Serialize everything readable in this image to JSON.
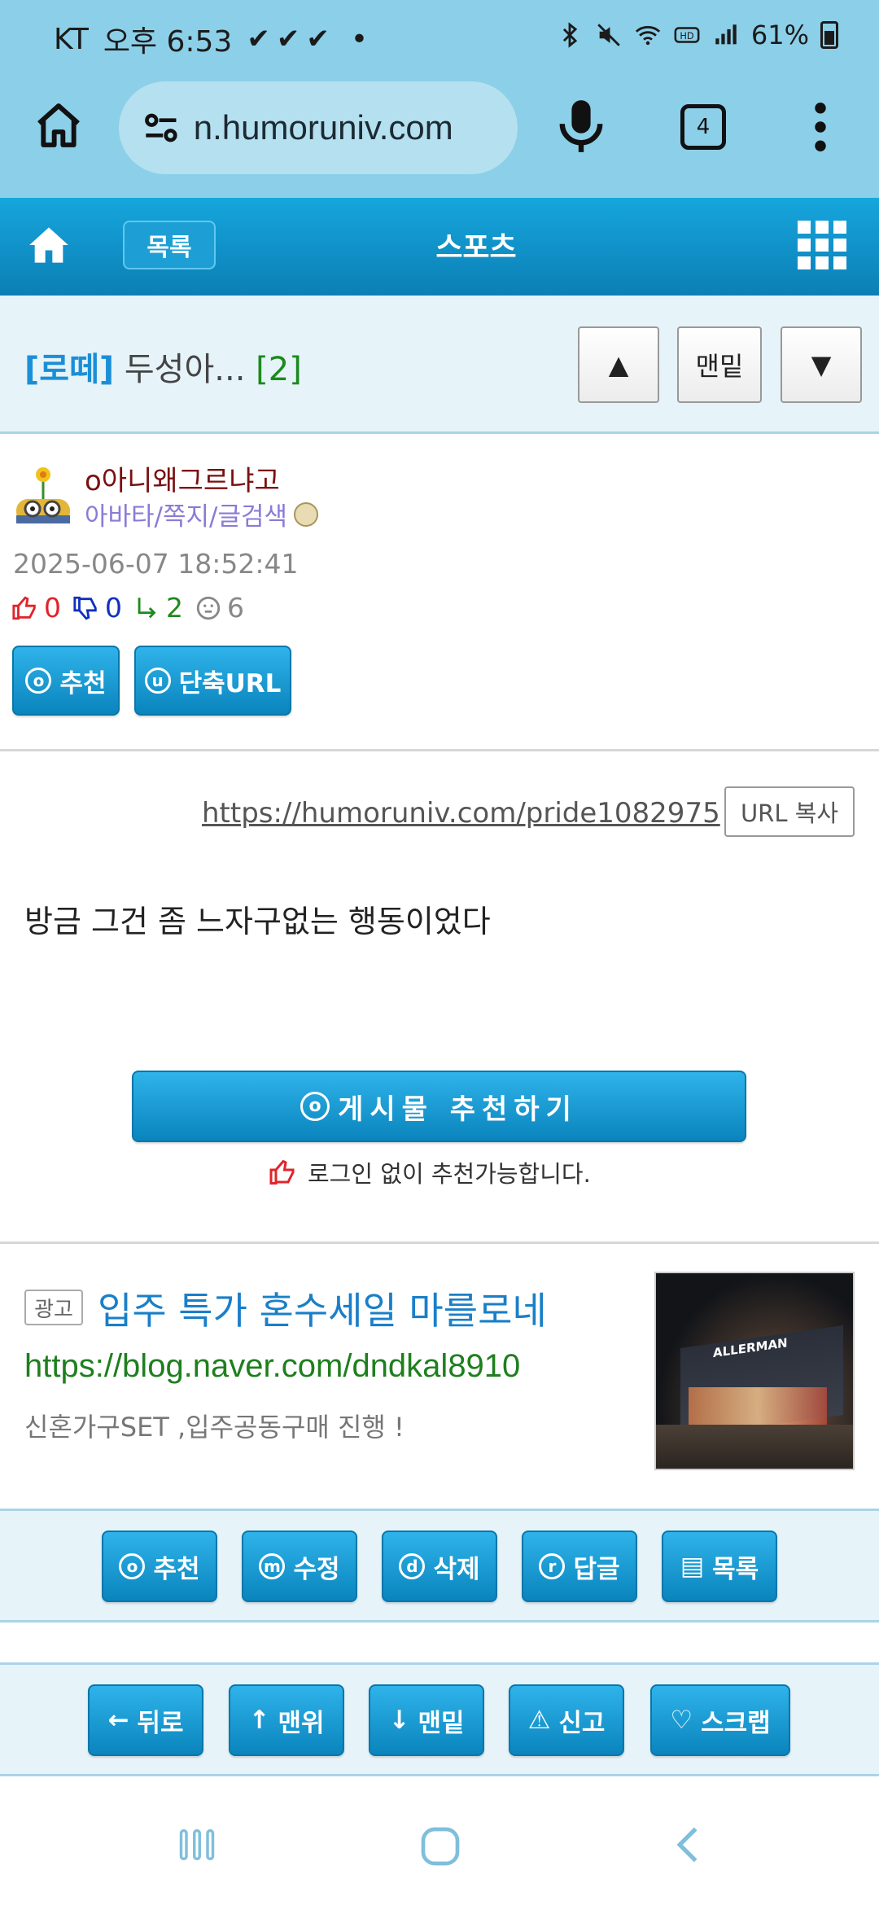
{
  "status_bar": {
    "carrier": "KT",
    "time": "오후 6:53",
    "checks": "✔✔✔",
    "dot": "•",
    "battery": "61%",
    "icons": [
      "bluetooth-icon",
      "mute-icon",
      "wifi-icon",
      "hd-icon",
      "signal-icon",
      "battery-icon"
    ]
  },
  "browser": {
    "url": "n.humoruniv.com",
    "tab_count": "4",
    "icons": [
      "home-icon",
      "site-settings-icon",
      "mic-icon",
      "tabs-icon",
      "more-icon"
    ]
  },
  "site_nav": {
    "list_label": "목록",
    "section_title": "스포츠",
    "accent_color": "#0b8fcf"
  },
  "post": {
    "category": "[로떼]",
    "title": " 두성아... ",
    "comment_count": "[2]",
    "nav_up": "▲",
    "nav_bottom": "맨밑",
    "nav_down": "▼"
  },
  "author": {
    "name": "o아니왜그르냐고",
    "links": "아바타/쪽지/글검색",
    "date": "2025-06-07 18:52:41",
    "stats": {
      "up": "0",
      "down": "0",
      "replies": "2",
      "views": "6"
    },
    "recommend_label": "추천",
    "shorturl_label": "단축URL",
    "recommend_circle": "o",
    "shorturl_circle": "u"
  },
  "content": {
    "url": "https://humoruniv.com/pride1082975",
    "url_copy_label": "URL 복사",
    "body": "방금 그건 좀 느자구없는 행동이었다",
    "big_recommend_label": "게시물  추천하기",
    "big_recommend_circle": "o",
    "recommend_note": "로그인 없이 추천가능합니다."
  },
  "ad": {
    "tag": "광고",
    "title": "입주 특가 혼수세일 마를로네",
    "link": "https://blog.naver.com/dndkal8910",
    "desc": "신혼가구SET ,입주공동구매 진행 !",
    "image_sign": "ALLERMAN"
  },
  "actions_top": [
    {
      "circle": "o",
      "label": "추천"
    },
    {
      "circle": "m",
      "label": "수정"
    },
    {
      "circle": "d",
      "label": "삭제"
    },
    {
      "circle": "r",
      "label": "답글"
    },
    {
      "circle": "▤",
      "label": "목록"
    }
  ],
  "actions_bottom": [
    {
      "glyph": "←",
      "label": "뒤로"
    },
    {
      "glyph": "↑",
      "label": "맨위"
    },
    {
      "glyph": "↓",
      "label": "맨밑"
    },
    {
      "glyph": "⚠",
      "label": "신고"
    },
    {
      "glyph": "♡",
      "label": "스크랩"
    }
  ]
}
